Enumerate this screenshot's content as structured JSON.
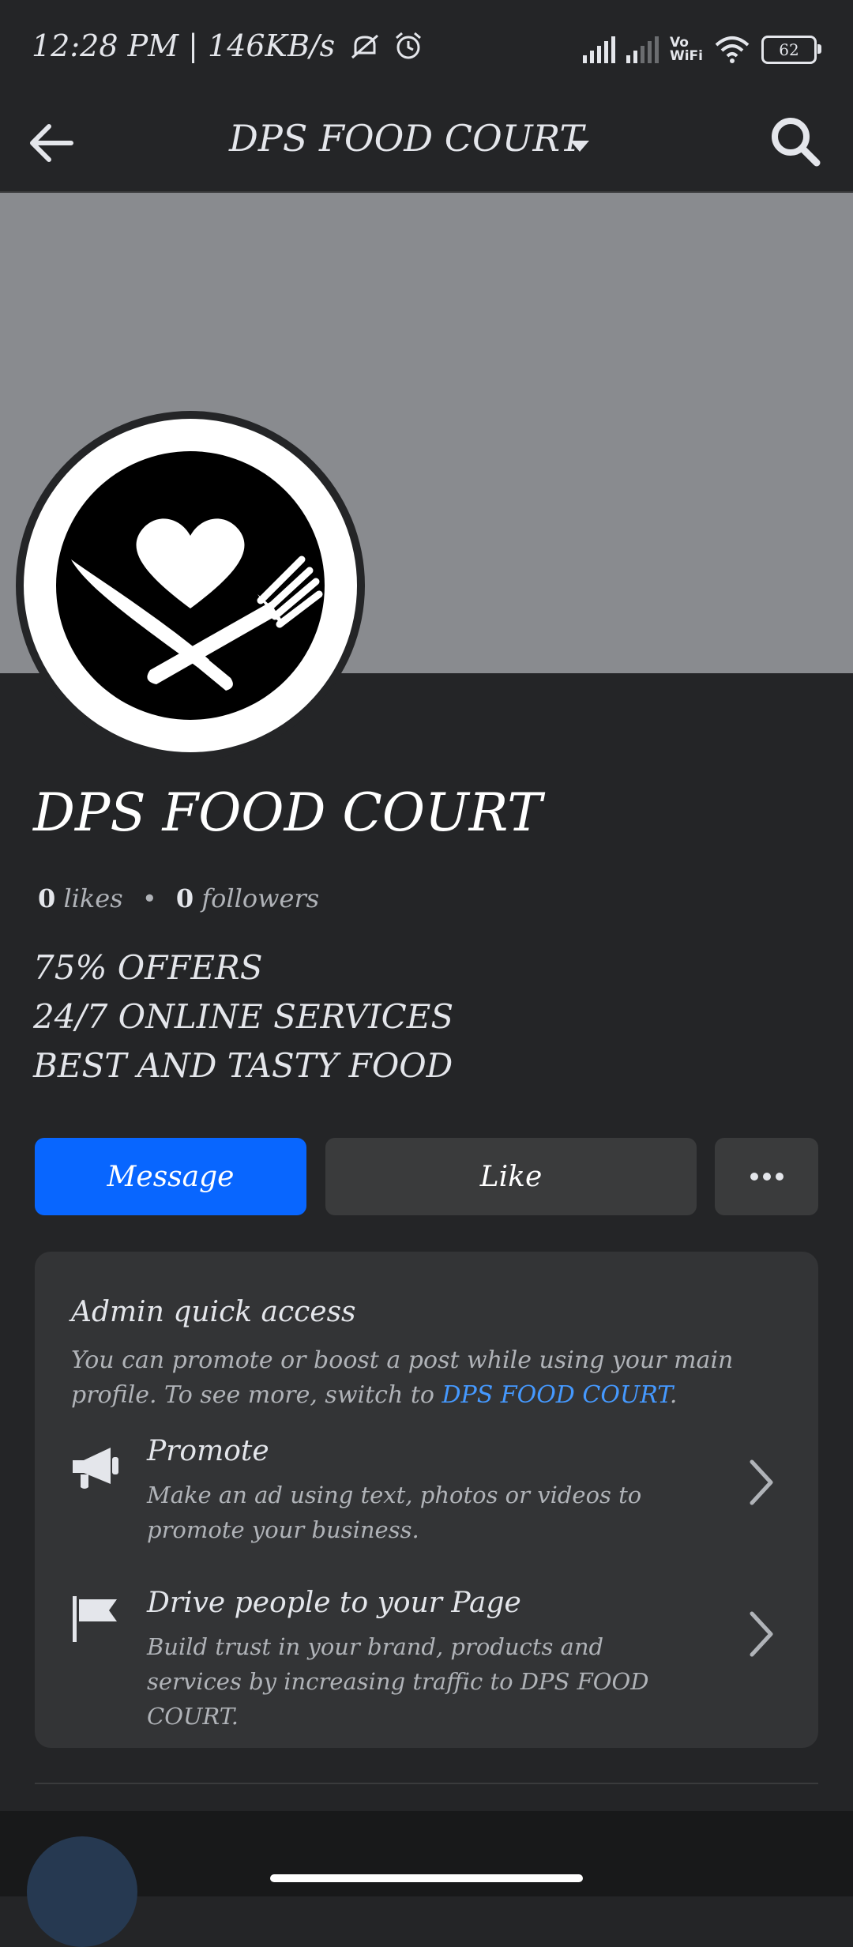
{
  "status_bar": {
    "time": "12:28 PM | 146KB/s",
    "battery": "62",
    "wifi_label_1": "Vo",
    "wifi_label_2": "WiFi"
  },
  "nav": {
    "title": "DPS FOOD COURT"
  },
  "page": {
    "name": "DPS FOOD COURT",
    "likes_count": "0",
    "likes_label": "likes",
    "followers_count": "0",
    "followers_label": "followers",
    "separator": "•",
    "bio": [
      "75% OFFERS",
      "24/7 ONLINE SERVICES",
      "BEST AND TASTY FOOD"
    ]
  },
  "actions": {
    "message": "Message",
    "like": "Like",
    "more": "•••"
  },
  "admin": {
    "title": "Admin quick access",
    "desc_prefix": "You can promote or boost a post while using your main profile. To see more, switch to ",
    "desc_link": "DPS FOOD COURT",
    "desc_suffix": ".",
    "items": [
      {
        "title": "Promote",
        "desc": "Make an ad using text, photos or videos to promote your business."
      },
      {
        "title": "Drive people to your Page",
        "desc": "Build trust in your brand, products and services by increasing traffic to DPS FOOD COURT."
      }
    ]
  },
  "colors": {
    "background": "#242527",
    "cover": "#898b8f",
    "primary_button": "#0866ff",
    "secondary_button": "#3a3b3c",
    "card": "#333436",
    "link": "#4599ff"
  },
  "icons": [
    "back-arrow-icon",
    "caret-down-icon",
    "search-icon",
    "megaphone-icon",
    "flag-icon",
    "chevron-right-icon",
    "more-icon"
  ]
}
